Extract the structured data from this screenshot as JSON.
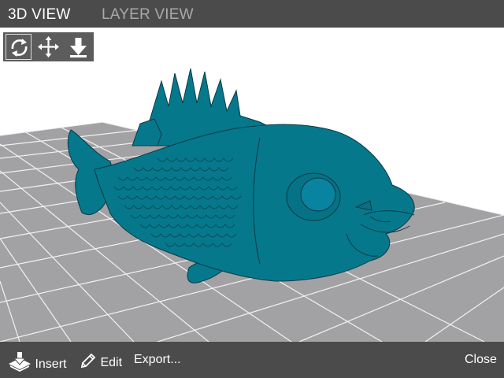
{
  "tabs": [
    {
      "label": "3D VIEW",
      "active": true
    },
    {
      "label": "LAYER VIEW",
      "active": false
    }
  ],
  "toolbar": {
    "tools": [
      {
        "name": "rotate",
        "icon": "rotate-icon",
        "active": true
      },
      {
        "name": "move",
        "icon": "move-icon",
        "active": false
      },
      {
        "name": "lay-flat",
        "icon": "lay-flat-icon",
        "active": false
      }
    ]
  },
  "viewport": {
    "model": "fish",
    "model_color": "#06788c",
    "plate_color": "#a2a2a5"
  },
  "bottom_bar": {
    "insert": {
      "label": "Insert",
      "icon": "insert-icon"
    },
    "edit": {
      "label": "Edit",
      "icon": "pencil-icon"
    },
    "export": {
      "label": "Export..."
    },
    "close": {
      "label": "Close"
    }
  },
  "colors": {
    "bar_bg": "#4b4b4b",
    "toolbar_bg": "#5c5c5c",
    "tab_active": "#ffffff",
    "tab_inactive": "#a9a9a9"
  }
}
